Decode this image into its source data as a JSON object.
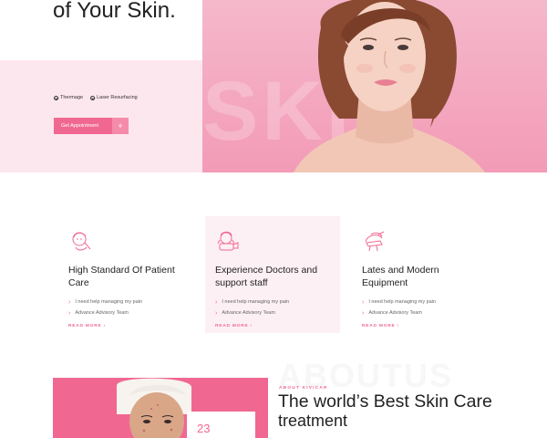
{
  "hero": {
    "title": "of Your Skin.",
    "watermark": "SKIN",
    "features": [
      "Thermage",
      "Laser Resurfacing"
    ],
    "cta_label": "Get Appointment",
    "cta_icon": "+"
  },
  "features": [
    {
      "icon": "face-care-icon",
      "title": "High Standard Of Patient Care",
      "items": [
        "I need help managing my pain",
        "Advance Advisory Team"
      ],
      "read_more": "READ MORE ›"
    },
    {
      "icon": "doctor-icon",
      "title": "Experience Doctors and support staff",
      "items": [
        "I need help managing my pain",
        "Advance Advisory Team"
      ],
      "read_more": "READ MORE ›"
    },
    {
      "icon": "equipment-icon",
      "title": "Lates and Modern Equipment",
      "items": [
        "I need help managing my pain",
        "Advance Advisory Team"
      ],
      "read_more": "READ MORE ›"
    }
  ],
  "about": {
    "watermark": "ABOUTUS",
    "eyebrow": "ABOUT KIVICAR",
    "title": "The world’s Best Skin Care",
    "subtitle": "treatment",
    "stat_number": "23"
  },
  "colors": {
    "accent": "#f06891",
    "hero_bg": "#f5b8cb",
    "soft_pink": "#fde7ee"
  }
}
